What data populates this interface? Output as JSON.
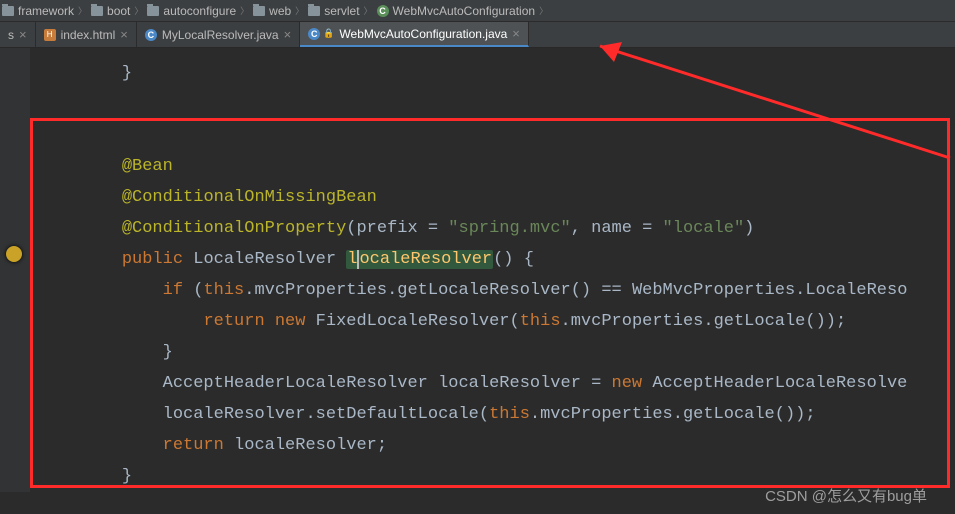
{
  "breadcrumbs": [
    {
      "label": "framework",
      "icon": "folder"
    },
    {
      "label": "boot",
      "icon": "folder"
    },
    {
      "label": "autoconfigure",
      "icon": "folder"
    },
    {
      "label": "web",
      "icon": "folder"
    },
    {
      "label": "servlet",
      "icon": "folder"
    },
    {
      "label": "WebMvcAutoConfiguration",
      "icon": "class"
    }
  ],
  "tabs": [
    {
      "label": "s",
      "icon": "none"
    },
    {
      "label": "index.html",
      "icon": "html"
    },
    {
      "label": "MyLocalResolver.java",
      "icon": "class"
    },
    {
      "label": "WebMvcAutoConfiguration.java",
      "icon": "class-lock",
      "active": true
    }
  ],
  "code": {
    "l0": "}",
    "ann_bean": "@Bean",
    "ann_cmb": "@ConditionalOnMissingBean",
    "ann_cop": "@ConditionalOnProperty",
    "prefix_lbl": "prefix",
    "prefix_val": "\"spring.mvc\"",
    "name_lbl": "name",
    "name_val": "\"locale\"",
    "kw_public": "public",
    "type_LR": "LocaleResolver",
    "fn_lr_a": "l",
    "fn_lr_b": "ocaleResolver",
    "kw_if": "if",
    "kw_this": "this",
    "mvcProps": "mvcProperties",
    "getLR": "getLocaleResolver",
    "eqeq": "==",
    "WebMvcProps": "WebMvcProperties",
    "LocaleResoTrunc": "LocaleReso",
    "kw_return": "return",
    "kw_new": "new",
    "Fixed": "FixedLocaleResolver",
    "getLocale": "getLocale",
    "AHLR": "AcceptHeaderLocaleResolver",
    "localeResolver": "localeResolver",
    "AHLR_trunc": "AcceptHeaderLocaleResolve",
    "setDef": "setDefaultLocale"
  },
  "watermark": "CSDN @怎么又有bug单"
}
